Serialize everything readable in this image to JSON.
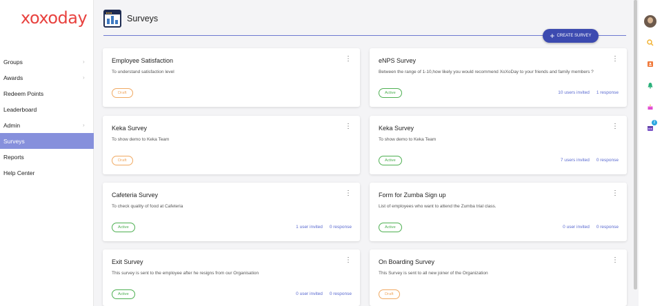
{
  "brand": {
    "name": "xoxoday",
    "color": "#e8423f"
  },
  "sidebar": {
    "items": [
      {
        "label": "Groups",
        "chevron": true
      },
      {
        "label": "Awards",
        "chevron": true
      },
      {
        "label": "Redeem Points",
        "chevron": false
      },
      {
        "label": "Leaderboard",
        "chevron": false
      },
      {
        "label": "Admin",
        "chevron": true
      },
      {
        "label": "Surveys",
        "chevron": false,
        "active": true
      },
      {
        "label": "Reports",
        "chevron": false
      },
      {
        "label": "Help Center",
        "chevron": false
      }
    ]
  },
  "header": {
    "title": "Surveys",
    "icon": "survey-dashboard-icon",
    "create_label": "CREATE SURVEY"
  },
  "cards": [
    {
      "title": "Employee Satisfaction",
      "description": "To understand satisfaction level",
      "status": "Draft",
      "invited": "",
      "responses": ""
    },
    {
      "title": "eNPS Survey",
      "description": "Between the range of 1-10,how likely you would recommend XoXoDay to your friends and family members ?",
      "status": "Active",
      "invited": "10 users invited",
      "responses": "1 response"
    },
    {
      "title": "Keka Survey",
      "description": "To show demo to Keka Team",
      "status": "Draft",
      "invited": "",
      "responses": ""
    },
    {
      "title": "Keka Survey",
      "description": "To show demo to Keka Team",
      "status": "Active",
      "invited": "7 users invited",
      "responses": "0 response"
    },
    {
      "title": "Cafeteria Survey",
      "description": "To check quality of food at Cafeteria",
      "status": "Active",
      "invited": "1 user invited",
      "responses": "0 response"
    },
    {
      "title": "Form for Zumba Sign up",
      "description": "List of employees who want to attend the Zumba trial class.",
      "status": "Active",
      "invited": "0 user invited",
      "responses": "0 response"
    },
    {
      "title": "Exit Survey",
      "description": "This survey is sent to the employee after he resigns from our Organisation",
      "status": "Active",
      "invited": "0 user invited",
      "responses": "0 response"
    },
    {
      "title": "On Boarding Survey",
      "description": "This Survey is sent to all new joiner of the Organization",
      "status": "Draft",
      "invited": "",
      "responses": ""
    }
  ],
  "rail": {
    "icons": [
      "avatar",
      "search-icon",
      "contact-card-icon",
      "bell-icon",
      "cake-icon",
      "calendar-icon"
    ],
    "calendar_badge": "2"
  },
  "colors": {
    "accent": "#3c4ab0",
    "active_nav": "#8690dc",
    "draft": "#f0a860",
    "active": "#4caf50",
    "link": "#5a6ad0"
  }
}
